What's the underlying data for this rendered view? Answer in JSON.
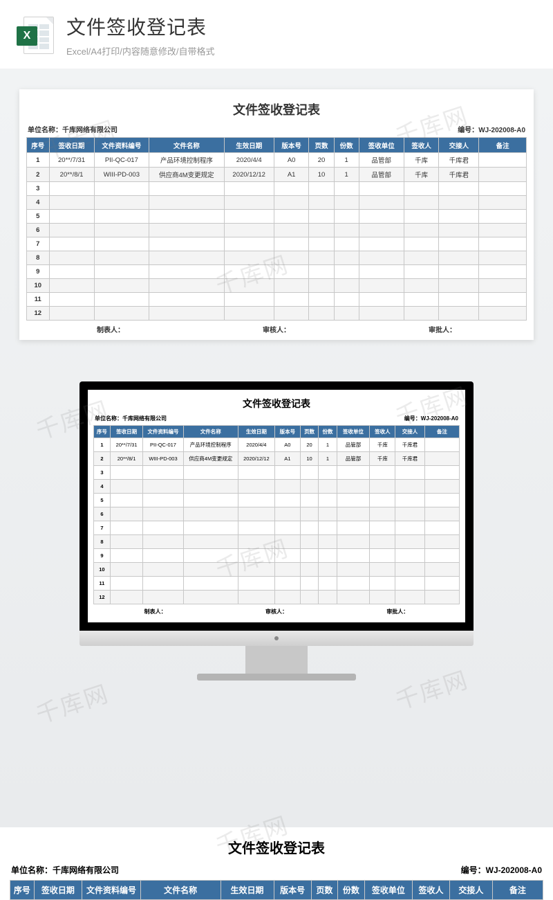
{
  "header": {
    "main_title": "文件签收登记表",
    "sub_title": "Excel/A4打印/内容随意修改/自带格式",
    "icon_letter": "X"
  },
  "sheet": {
    "title": "文件签收登记表",
    "unit_label": "单位名称：",
    "unit_value": "千库网络有限公司",
    "code_label": "编号：",
    "code_value": "WJ-202008-A0",
    "columns": [
      "序号",
      "签收日期",
      "文件资料编号",
      "文件名称",
      "生效日期",
      "版本号",
      "页数",
      "份数",
      "签收单位",
      "签收人",
      "交接人",
      "备注"
    ],
    "rows": [
      {
        "no": "1",
        "date": "20**/7/31",
        "docno": "PII-QC-017",
        "name": "产品环境控制程序",
        "eff": "2020/4/4",
        "ver": "A0",
        "pages": "20",
        "copies": "1",
        "dept": "品管部",
        "signer": "千库",
        "handover": "千库君",
        "remark": ""
      },
      {
        "no": "2",
        "date": "20**/8/1",
        "docno": "WIII-PD-003",
        "name": "供应商4M变更规定",
        "eff": "2020/12/12",
        "ver": "A1",
        "pages": "10",
        "copies": "1",
        "dept": "品管部",
        "signer": "千库",
        "handover": "千库君",
        "remark": ""
      }
    ],
    "empty_rows": [
      "3",
      "4",
      "5",
      "6",
      "7",
      "8",
      "9",
      "10",
      "11",
      "12"
    ],
    "footer": {
      "maker": "制表人：",
      "checker": "审核人：",
      "approver": "审批人："
    }
  },
  "watermark_text": "千库网",
  "chart_data": {
    "type": "table",
    "title": "文件签收登记表",
    "columns": [
      "序号",
      "签收日期",
      "文件资料编号",
      "文件名称",
      "生效日期",
      "版本号",
      "页数",
      "份数",
      "签收单位",
      "签收人",
      "交接人",
      "备注"
    ],
    "rows": [
      [
        "1",
        "20**/7/31",
        "PII-QC-017",
        "产品环境控制程序",
        "2020/4/4",
        "A0",
        20,
        1,
        "品管部",
        "千库",
        "千库君",
        ""
      ],
      [
        "2",
        "20**/8/1",
        "WIII-PD-003",
        "供应商4M变更规定",
        "2020/12/12",
        "A1",
        10,
        1,
        "品管部",
        "千库",
        "千库君",
        ""
      ]
    ],
    "meta": {
      "unit": "千库网络有限公司",
      "code": "WJ-202008-A0"
    }
  }
}
